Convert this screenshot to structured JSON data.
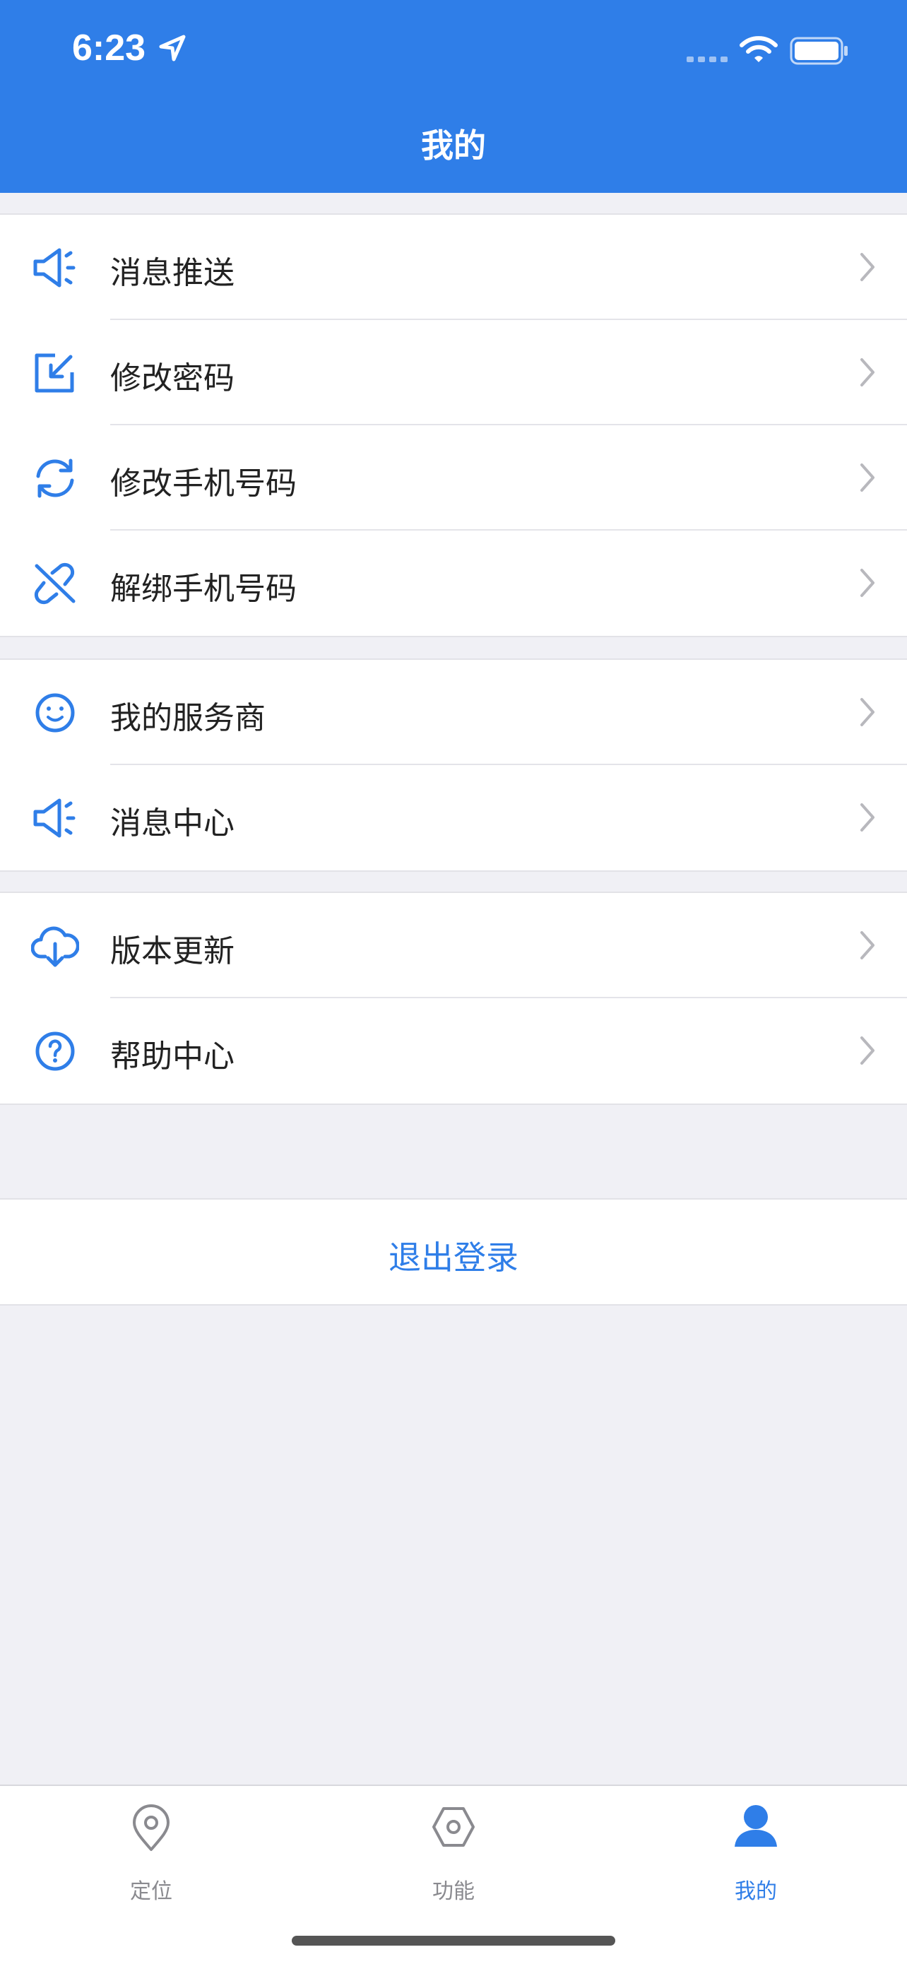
{
  "status_bar": {
    "time": "6:23"
  },
  "header": {
    "title": "我的"
  },
  "colors": {
    "accent": "#2f7ee8",
    "background": "#f0f0f5",
    "chevron": "#b8b8bd",
    "inactive": "#8a8a8f"
  },
  "groups": [
    {
      "items": [
        {
          "label": "消息推送",
          "icon": "megaphone-icon"
        },
        {
          "label": "修改密码",
          "icon": "edit-box-icon"
        },
        {
          "label": "修改手机号码",
          "icon": "refresh-icon"
        },
        {
          "label": "解绑手机号码",
          "icon": "unlink-icon"
        }
      ]
    },
    {
      "items": [
        {
          "label": "我的服务商",
          "icon": "smile-icon"
        },
        {
          "label": "消息中心",
          "icon": "megaphone-icon"
        }
      ]
    },
    {
      "items": [
        {
          "label": "版本更新",
          "icon": "cloud-download-icon"
        },
        {
          "label": "帮助中心",
          "icon": "help-circle-icon"
        }
      ]
    }
  ],
  "logout": {
    "label": "退出登录"
  },
  "tabbar": {
    "tabs": [
      {
        "label": "定位",
        "icon": "location-pin-icon",
        "active": false
      },
      {
        "label": "功能",
        "icon": "hexagon-nut-icon",
        "active": false
      },
      {
        "label": "我的",
        "icon": "user-icon",
        "active": true
      }
    ]
  }
}
